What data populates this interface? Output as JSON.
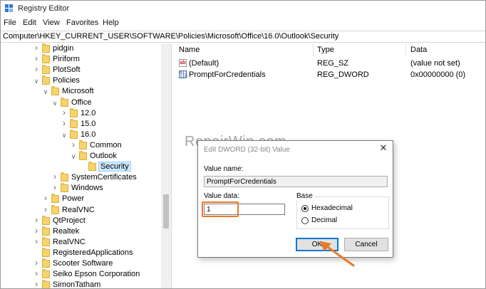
{
  "window": {
    "title": "Registry Editor"
  },
  "menu": [
    "File",
    "Edit",
    "View",
    "Favorites",
    "Help"
  ],
  "address": "Computer\\HKEY_CURRENT_USER\\SOFTWARE\\Policies\\Microsoft\\Office\\16.0\\Outlook\\Security",
  "tree": [
    {
      "label": "pidgin",
      "depth": 0,
      "expanded": false
    },
    {
      "label": "Piriform",
      "depth": 0,
      "expanded": false
    },
    {
      "label": "PlotSoft",
      "depth": 0,
      "expanded": false
    },
    {
      "label": "Policies",
      "depth": 0,
      "expanded": true
    },
    {
      "label": "Microsoft",
      "depth": 1,
      "expanded": true
    },
    {
      "label": "Office",
      "depth": 2,
      "expanded": true
    },
    {
      "label": "12.0",
      "depth": 3,
      "expanded": false
    },
    {
      "label": "15.0",
      "depth": 3,
      "expanded": false
    },
    {
      "label": "16.0",
      "depth": 3,
      "expanded": true
    },
    {
      "label": "Common",
      "depth": 4,
      "expanded": false
    },
    {
      "label": "Outlook",
      "depth": 4,
      "expanded": true
    },
    {
      "label": "Security",
      "depth": 5,
      "expanded": null,
      "selected": true
    },
    {
      "label": "SystemCertificates",
      "depth": 2,
      "expanded": false
    },
    {
      "label": "Windows",
      "depth": 2,
      "expanded": false
    },
    {
      "label": "Power",
      "depth": 1,
      "expanded": false
    },
    {
      "label": "RealVNC",
      "depth": 1,
      "expanded": false
    },
    {
      "label": "QtProject",
      "depth": 0,
      "expanded": false
    },
    {
      "label": "Realtek",
      "depth": 0,
      "expanded": false
    },
    {
      "label": "RealVNC",
      "depth": 0,
      "expanded": false
    },
    {
      "label": "RegisteredApplications",
      "depth": 0,
      "expanded": null
    },
    {
      "label": "Scooter Software",
      "depth": 0,
      "expanded": false
    },
    {
      "label": "Seiko Epson Corporation",
      "depth": 0,
      "expanded": false
    },
    {
      "label": "SimonTatham",
      "depth": 0,
      "expanded": false
    }
  ],
  "list": {
    "headers": {
      "name": "Name",
      "type": "Type",
      "data": "Data"
    },
    "rows": [
      {
        "icon": "string-value-icon",
        "icon_text": "ab",
        "name": "(Default)",
        "type": "REG_SZ",
        "data": "(value not set)"
      },
      {
        "icon": "binary-value-icon",
        "icon_text": "011\n110",
        "name": "PromptForCredentials",
        "type": "REG_DWORD",
        "data": "0x00000000 (0)"
      }
    ]
  },
  "watermark": "RepairWin.com",
  "dialog": {
    "title": "Edit DWORD (32-bit) Value",
    "value_name_label": "Value name:",
    "value_name": "PromptForCredentials",
    "value_data_label": "Value data:",
    "value_data": "1",
    "base_label": "Base",
    "base_options": [
      "Hexadecimal",
      "Decimal"
    ],
    "base_selected": "Hexadecimal",
    "ok_label": "OK",
    "cancel_label": "Cancel",
    "close_glyph": "✕"
  },
  "colors": {
    "highlight": "#e8782a",
    "selection": "#cce8ff",
    "folder": "#f6d36b",
    "accent": "#0078d7"
  }
}
